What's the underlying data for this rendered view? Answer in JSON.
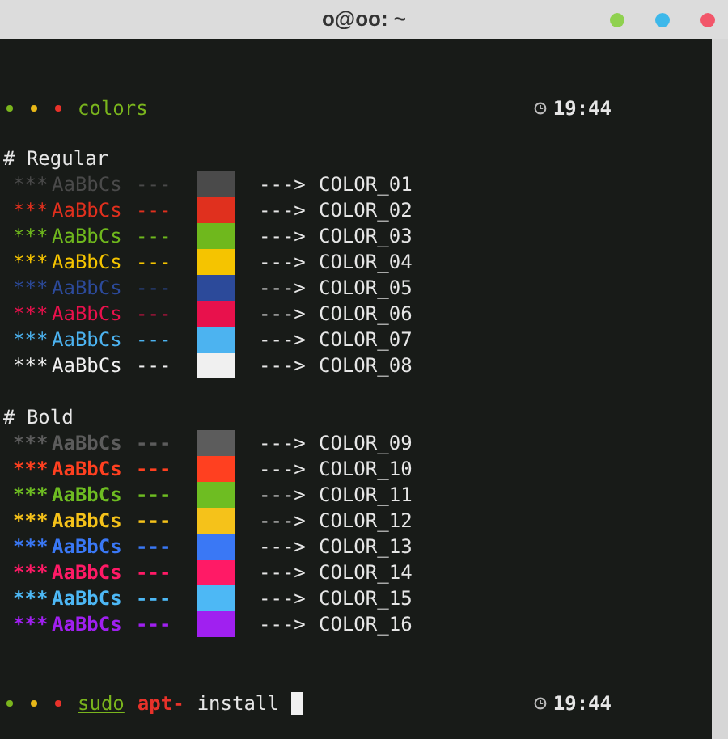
{
  "window": {
    "title": "o@oo: ~",
    "controls": [
      {
        "color": "#8fd14f"
      },
      {
        "color": "#3db8ea"
      },
      {
        "color": "#f2566a"
      }
    ]
  },
  "top_prompt": {
    "dots": [
      {
        "color": "#7ab51d"
      },
      {
        "color": "#e8b818"
      },
      {
        "color": "#e8322a"
      }
    ],
    "segments": [
      {
        "text": "colors",
        "kind": "command"
      }
    ],
    "time": "19:44"
  },
  "sections": [
    {
      "heading": "# Regular",
      "bold": false,
      "rows": [
        {
          "stars": "***",
          "sample": "AaBbCs",
          "dashes": "---",
          "color": "#4a4a4a",
          "arrow": "--->",
          "name": "COLOR_01"
        },
        {
          "stars": "***",
          "sample": "AaBbCs",
          "dashes": "---",
          "color": "#e0301e",
          "arrow": "--->",
          "name": "COLOR_02"
        },
        {
          "stars": "***",
          "sample": "AaBbCs",
          "dashes": "---",
          "color": "#6fb81d",
          "arrow": "--->",
          "name": "COLOR_03"
        },
        {
          "stars": "***",
          "sample": "AaBbCs",
          "dashes": "---",
          "color": "#f5c400",
          "arrow": "--->",
          "name": "COLOR_04"
        },
        {
          "stars": "***",
          "sample": "AaBbCs",
          "dashes": "---",
          "color": "#2c4a9a",
          "arrow": "--->",
          "name": "COLOR_05"
        },
        {
          "stars": "***",
          "sample": "AaBbCs",
          "dashes": "---",
          "color": "#e8114c",
          "arrow": "--->",
          "name": "COLOR_06"
        },
        {
          "stars": "***",
          "sample": "AaBbCs",
          "dashes": "---",
          "color": "#4cb3f0",
          "arrow": "--->",
          "name": "COLOR_07"
        },
        {
          "stars": "***",
          "sample": "AaBbCs",
          "dashes": "---",
          "color": "#f0f0f0",
          "arrow": "--->",
          "name": "COLOR_08"
        }
      ]
    },
    {
      "heading": "# Bold",
      "bold": true,
      "rows": [
        {
          "stars": "***",
          "sample": "AaBbCs",
          "dashes": "---",
          "color": "#5c5c5c",
          "arrow": "--->",
          "name": "COLOR_09"
        },
        {
          "stars": "***",
          "sample": "AaBbCs",
          "dashes": "---",
          "color": "#ff4020",
          "arrow": "--->",
          "name": "COLOR_10"
        },
        {
          "stars": "***",
          "sample": "AaBbCs",
          "dashes": "---",
          "color": "#6ebd22",
          "arrow": "--->",
          "name": "COLOR_11"
        },
        {
          "stars": "***",
          "sample": "AaBbCs",
          "dashes": "---",
          "color": "#f5c21a",
          "arrow": "--->",
          "name": "COLOR_12"
        },
        {
          "stars": "***",
          "sample": "AaBbCs",
          "dashes": "---",
          "color": "#3a78f5",
          "arrow": "--->",
          "name": "COLOR_13"
        },
        {
          "stars": "***",
          "sample": "AaBbCs",
          "dashes": "---",
          "color": "#ff1a66",
          "arrow": "--->",
          "name": "COLOR_14"
        },
        {
          "stars": "***",
          "sample": "AaBbCs",
          "dashes": "---",
          "color": "#4db8f5",
          "arrow": "--->",
          "name": "COLOR_15"
        },
        {
          "stars": "***",
          "sample": "AaBbCs",
          "dashes": "---",
          "color": "#a020f0",
          "arrow": "--->",
          "name": "COLOR_16"
        }
      ]
    }
  ],
  "bottom_prompt": {
    "dots": [
      {
        "color": "#7ab51d"
      },
      {
        "color": "#e8b818"
      },
      {
        "color": "#e8322a"
      }
    ],
    "segments": [
      {
        "text": "sudo",
        "kind": "command"
      },
      {
        "text": "apt-",
        "kind": "error"
      },
      {
        "text": "install",
        "kind": "argument"
      }
    ],
    "cursor": true,
    "time": "19:44"
  }
}
